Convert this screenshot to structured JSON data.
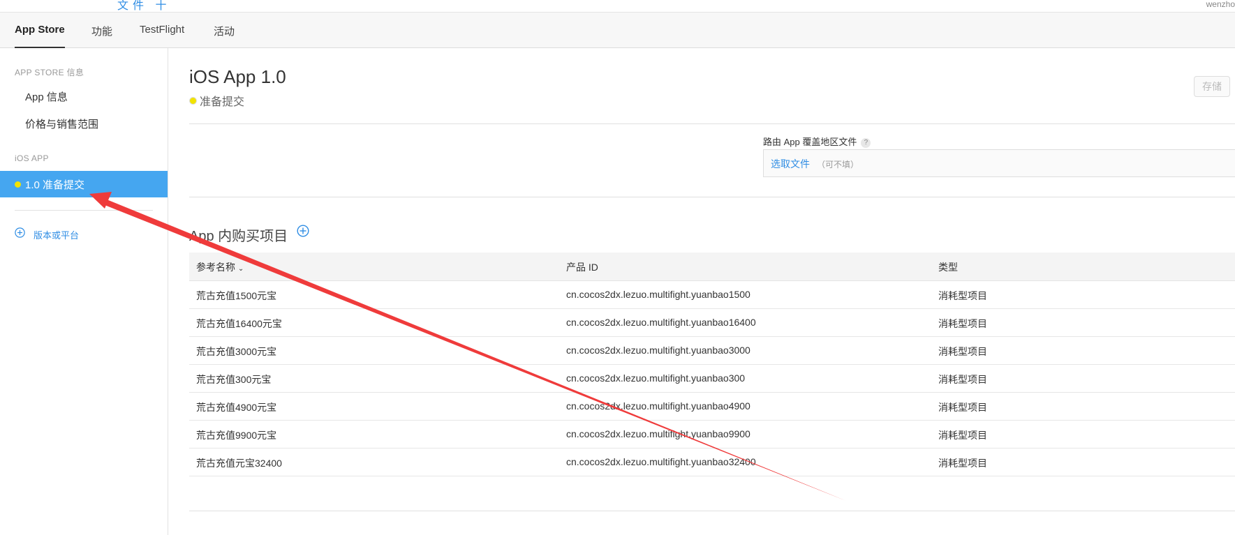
{
  "top": {
    "blue_fragment": "文件 十",
    "user": "wenzho"
  },
  "tabs": [
    {
      "label": "App Store",
      "active": true
    },
    {
      "label": "功能"
    },
    {
      "label": "TestFlight"
    },
    {
      "label": "活动"
    }
  ],
  "sidebar": {
    "section_appstore": "APP STORE 信息",
    "app_info": "App 信息",
    "pricing": "价格与销售范围",
    "section_ios": "iOS APP",
    "active_version": "1.0 准备提交",
    "add_version": "版本或平台"
  },
  "main": {
    "title": "iOS App 1.0",
    "status": "准备提交",
    "save": "存储",
    "route_label": "路由 App 覆盖地区文件",
    "help": "?",
    "pick_file": "选取文件",
    "optional": "（可不填）",
    "iap_title": "App 内购买项目"
  },
  "table": {
    "headers": {
      "name": "参考名称",
      "product_id": "产品 ID",
      "type": "类型"
    },
    "rows": [
      {
        "name": "荒古充值1500元宝",
        "product_id": "cn.cocos2dx.lezuo.multifight.yuanbao1500",
        "type": "消耗型项目"
      },
      {
        "name": "荒古充值16400元宝",
        "product_id": "cn.cocos2dx.lezuo.multifight.yuanbao16400",
        "type": "消耗型项目"
      },
      {
        "name": "荒古充值3000元宝",
        "product_id": "cn.cocos2dx.lezuo.multifight.yuanbao3000",
        "type": "消耗型项目"
      },
      {
        "name": "荒古充值300元宝",
        "product_id": "cn.cocos2dx.lezuo.multifight.yuanbao300",
        "type": "消耗型项目"
      },
      {
        "name": "荒古充值4900元宝",
        "product_id": "cn.cocos2dx.lezuo.multifight.yuanbao4900",
        "type": "消耗型项目"
      },
      {
        "name": "荒古充值9900元宝",
        "product_id": "cn.cocos2dx.lezuo.multifight.yuanbao9900",
        "type": "消耗型项目"
      },
      {
        "name": "荒古充值元宝32400",
        "product_id": "cn.cocos2dx.lezuo.multifight.yuanbao32400",
        "type": "消耗型项目"
      }
    ]
  },
  "colors": {
    "accent": "#2f8de4",
    "selected": "#45a6f0",
    "status_dot": "#f2e300",
    "annotation": "#ef3b3b"
  }
}
